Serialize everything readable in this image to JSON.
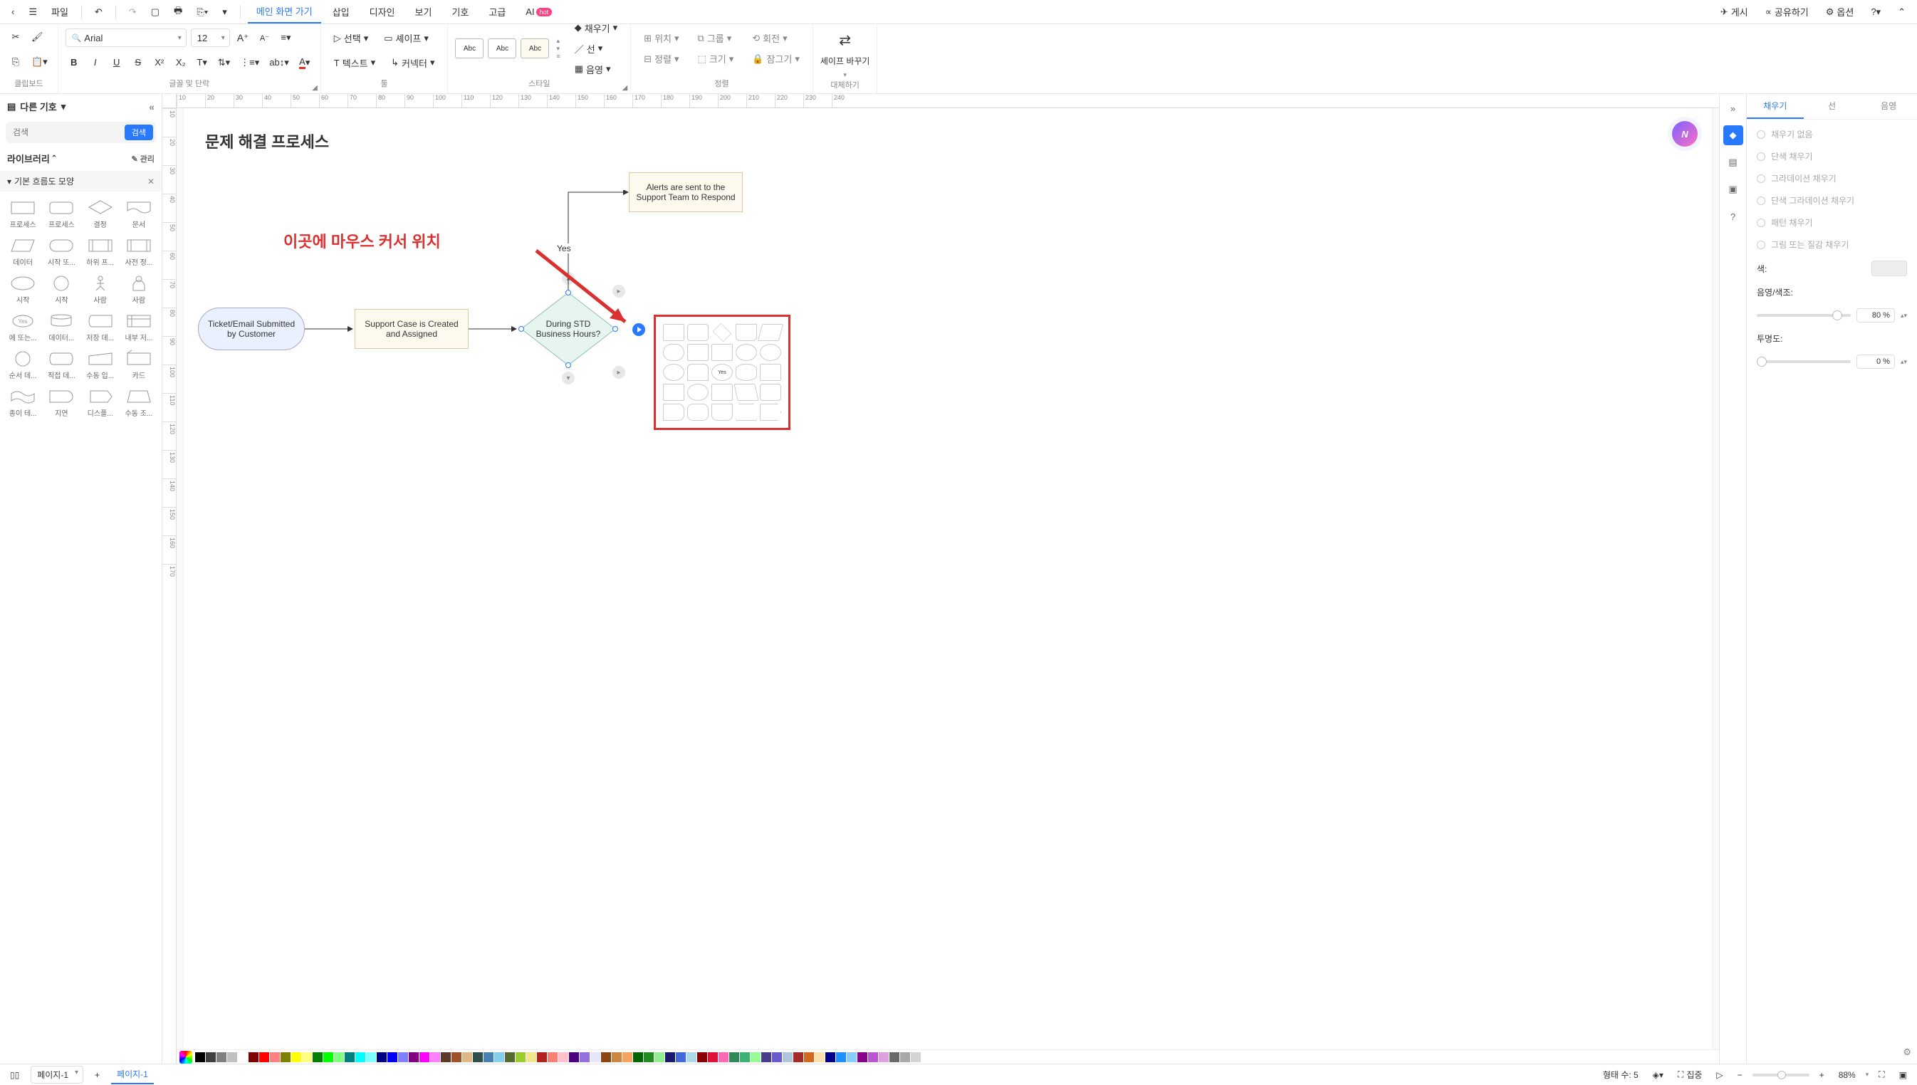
{
  "topbar": {
    "file": "파일",
    "tabs": [
      "메인 화면 가기",
      "삽입",
      "디자인",
      "보기",
      "기호",
      "고급"
    ],
    "ai": "AI",
    "ai_badge": "hot",
    "publish": "게시",
    "share": "공유하기",
    "options": "옵션"
  },
  "ribbon": {
    "clipboard": "클립보드",
    "font_label": "글꼴 및 단락",
    "font": "Arial",
    "size": "12",
    "tools_label": "툴",
    "select": "선택",
    "shape": "셰이프",
    "text": "텍스트",
    "connector": "커넥터",
    "style_label": "스타일",
    "style_text": "Abc",
    "style_fill": "채우기",
    "style_line": "선",
    "style_shadow": "음영",
    "arrange_label": "정렬",
    "arr_position": "위치",
    "arr_group": "그룹",
    "arr_rotate": "회전",
    "arr_align": "정렬",
    "arr_size": "크기",
    "arr_lock": "잠그기",
    "replace_label": "대체하기",
    "replace": "셰이프 바꾸기"
  },
  "left": {
    "title": "다른 기호",
    "search_ph": "검색",
    "search_btn": "검색",
    "library": "라이브러리",
    "manage": "관리",
    "category": "기본 흐름도 모양",
    "shapes": [
      "프로세스",
      "프로세스",
      "결정",
      "문서",
      "데이터",
      "시작 또...",
      "하위 프...",
      "사전 정...",
      "시작",
      "시작",
      "사람",
      "사람",
      "에 또는...",
      "데이터...",
      "저장 데...",
      "내부 저...",
      "순서 데...",
      "직접 데...",
      "수동 입...",
      "카드",
      "종이 테...",
      "지연",
      "디스플...",
      "수동 조..."
    ]
  },
  "canvas": {
    "title": "문제 해결 프로세스",
    "node1": "Ticket/Email Submitted by Customer",
    "node2": "Support Case is Created and Assigned",
    "node3": "During STD Business Hours?",
    "node4": "Alerts are sent to the Support Team to Respond",
    "yes": "Yes",
    "annotation": "이곳에 마우스 커서 위치",
    "ruler_h": [
      "10",
      "20",
      "30",
      "40",
      "50",
      "60",
      "70",
      "80",
      "90",
      "100",
      "110",
      "120",
      "130",
      "140",
      "150",
      "160",
      "170",
      "180",
      "190",
      "200",
      "210",
      "220",
      "230",
      "240"
    ],
    "ruler_v": [
      "10",
      "20",
      "30",
      "40",
      "50",
      "60",
      "70",
      "80",
      "90",
      "100",
      "110",
      "120",
      "130",
      "140",
      "150",
      "160",
      "170"
    ]
  },
  "right": {
    "tabs": [
      "채우기",
      "선",
      "음영"
    ],
    "opts": [
      "채우기 없음",
      "단색 채우기",
      "그라데이션 채우기",
      "단색 그라데이션 채우기",
      "패턴 채우기",
      "그림 또는 질감 채우기"
    ],
    "color": "색:",
    "tint": "음영/색조:",
    "tint_val": "80 %",
    "opacity": "투명도:",
    "opacity_val": "0 %"
  },
  "status": {
    "page_sel": "페이지-1",
    "page_tab": "페이지-1",
    "shape_count": "형태 수: 5",
    "focus": "집중",
    "zoom": "88%"
  },
  "palette": [
    "#000000",
    "#404040",
    "#808080",
    "#c0c0c0",
    "#ffffff",
    "#800000",
    "#ff0000",
    "#ff8080",
    "#808000",
    "#ffff00",
    "#ffff80",
    "#008000",
    "#00ff00",
    "#80ff80",
    "#008080",
    "#00ffff",
    "#80ffff",
    "#000080",
    "#0000ff",
    "#8080ff",
    "#800080",
    "#ff00ff",
    "#ff80ff",
    "#5b3a29",
    "#a0522d",
    "#deb887",
    "#2f4f4f",
    "#4682b4",
    "#87ceeb",
    "#556b2f",
    "#9acd32",
    "#f0e68c",
    "#b22222",
    "#fa8072",
    "#ffc0cb",
    "#4b0082",
    "#9370db",
    "#e6e6fa",
    "#8b4513",
    "#cd853f",
    "#f4a460",
    "#006400",
    "#228b22",
    "#90ee90",
    "#191970",
    "#4169e1",
    "#add8e6",
    "#8b0000",
    "#dc143c",
    "#ff69b4",
    "#2e8b57",
    "#3cb371",
    "#98fb98",
    "#483d8b",
    "#6a5acd",
    "#b0c4de",
    "#a52a2a",
    "#d2691e",
    "#ffdead",
    "#00008b",
    "#1e90ff",
    "#87cefa",
    "#8b008b",
    "#ba55d3",
    "#dda0dd",
    "#696969",
    "#a9a9a9",
    "#d3d3d3"
  ]
}
